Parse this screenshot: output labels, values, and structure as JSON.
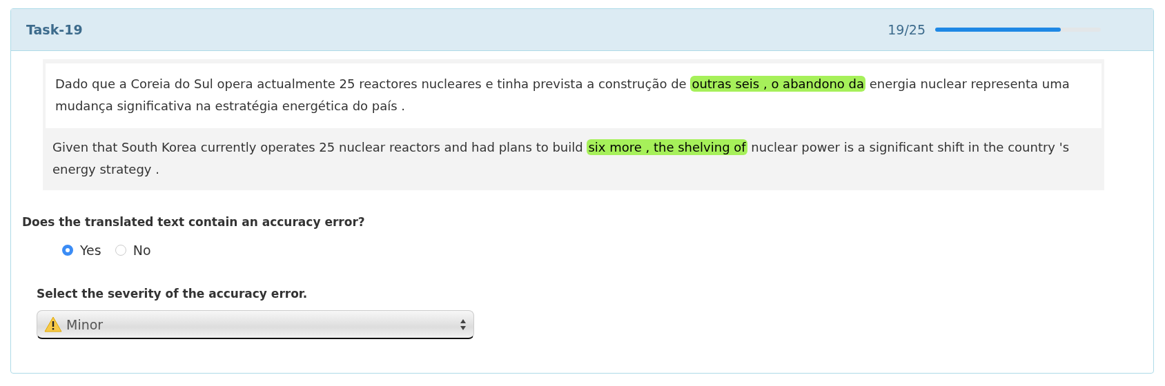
{
  "task": {
    "title": "Task-19",
    "progress_text": "19/25",
    "level": 0.76
  },
  "source": [
    {
      "text": "Dado que a Coreia do Sul opera actualmente 25 reactores nucleares e tinha prevista a construção de ",
      "highlighted": false
    },
    {
      "text": "outras seis , o abandono da",
      "highlighted": true
    },
    {
      "text": " energia nuclear representa uma mudança significativa na estratégia energética do país .",
      "highlighted": false
    }
  ],
  "translation": [
    {
      "text": "Given that South Korea currently operates 25 nuclear reactors and had plans to build ",
      "highlighted": false
    },
    {
      "text": "six more , the shelving of",
      "highlighted": true
    },
    {
      "text": " nuclear power is a significant shift in the country 's energy strategy .",
      "highlighted": false
    }
  ],
  "question": "Does the translated text contain an accuracy error?",
  "options": [
    {
      "label": "Yes",
      "selected": true
    },
    {
      "label": "No",
      "selected": false
    }
  ],
  "severity": {
    "label": "Select the severity of the accuracy error.",
    "value": "Minor"
  }
}
